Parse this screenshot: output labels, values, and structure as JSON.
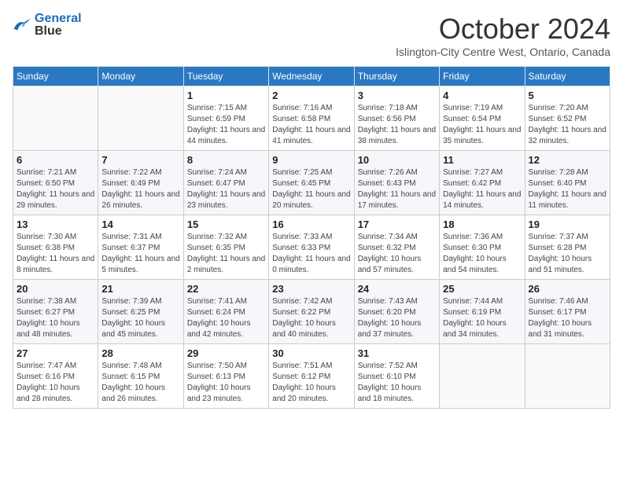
{
  "header": {
    "logo_line1": "General",
    "logo_line2": "Blue",
    "month": "October 2024",
    "location": "Islington-City Centre West, Ontario, Canada"
  },
  "weekdays": [
    "Sunday",
    "Monday",
    "Tuesday",
    "Wednesday",
    "Thursday",
    "Friday",
    "Saturday"
  ],
  "weeks": [
    [
      {
        "day": "",
        "detail": ""
      },
      {
        "day": "",
        "detail": ""
      },
      {
        "day": "1",
        "detail": "Sunrise: 7:15 AM\nSunset: 6:59 PM\nDaylight: 11 hours and 44 minutes."
      },
      {
        "day": "2",
        "detail": "Sunrise: 7:16 AM\nSunset: 6:58 PM\nDaylight: 11 hours and 41 minutes."
      },
      {
        "day": "3",
        "detail": "Sunrise: 7:18 AM\nSunset: 6:56 PM\nDaylight: 11 hours and 38 minutes."
      },
      {
        "day": "4",
        "detail": "Sunrise: 7:19 AM\nSunset: 6:54 PM\nDaylight: 11 hours and 35 minutes."
      },
      {
        "day": "5",
        "detail": "Sunrise: 7:20 AM\nSunset: 6:52 PM\nDaylight: 11 hours and 32 minutes."
      }
    ],
    [
      {
        "day": "6",
        "detail": "Sunrise: 7:21 AM\nSunset: 6:50 PM\nDaylight: 11 hours and 29 minutes."
      },
      {
        "day": "7",
        "detail": "Sunrise: 7:22 AM\nSunset: 6:49 PM\nDaylight: 11 hours and 26 minutes."
      },
      {
        "day": "8",
        "detail": "Sunrise: 7:24 AM\nSunset: 6:47 PM\nDaylight: 11 hours and 23 minutes."
      },
      {
        "day": "9",
        "detail": "Sunrise: 7:25 AM\nSunset: 6:45 PM\nDaylight: 11 hours and 20 minutes."
      },
      {
        "day": "10",
        "detail": "Sunrise: 7:26 AM\nSunset: 6:43 PM\nDaylight: 11 hours and 17 minutes."
      },
      {
        "day": "11",
        "detail": "Sunrise: 7:27 AM\nSunset: 6:42 PM\nDaylight: 11 hours and 14 minutes."
      },
      {
        "day": "12",
        "detail": "Sunrise: 7:28 AM\nSunset: 6:40 PM\nDaylight: 11 hours and 11 minutes."
      }
    ],
    [
      {
        "day": "13",
        "detail": "Sunrise: 7:30 AM\nSunset: 6:38 PM\nDaylight: 11 hours and 8 minutes."
      },
      {
        "day": "14",
        "detail": "Sunrise: 7:31 AM\nSunset: 6:37 PM\nDaylight: 11 hours and 5 minutes."
      },
      {
        "day": "15",
        "detail": "Sunrise: 7:32 AM\nSunset: 6:35 PM\nDaylight: 11 hours and 2 minutes."
      },
      {
        "day": "16",
        "detail": "Sunrise: 7:33 AM\nSunset: 6:33 PM\nDaylight: 11 hours and 0 minutes."
      },
      {
        "day": "17",
        "detail": "Sunrise: 7:34 AM\nSunset: 6:32 PM\nDaylight: 10 hours and 57 minutes."
      },
      {
        "day": "18",
        "detail": "Sunrise: 7:36 AM\nSunset: 6:30 PM\nDaylight: 10 hours and 54 minutes."
      },
      {
        "day": "19",
        "detail": "Sunrise: 7:37 AM\nSunset: 6:28 PM\nDaylight: 10 hours and 51 minutes."
      }
    ],
    [
      {
        "day": "20",
        "detail": "Sunrise: 7:38 AM\nSunset: 6:27 PM\nDaylight: 10 hours and 48 minutes."
      },
      {
        "day": "21",
        "detail": "Sunrise: 7:39 AM\nSunset: 6:25 PM\nDaylight: 10 hours and 45 minutes."
      },
      {
        "day": "22",
        "detail": "Sunrise: 7:41 AM\nSunset: 6:24 PM\nDaylight: 10 hours and 42 minutes."
      },
      {
        "day": "23",
        "detail": "Sunrise: 7:42 AM\nSunset: 6:22 PM\nDaylight: 10 hours and 40 minutes."
      },
      {
        "day": "24",
        "detail": "Sunrise: 7:43 AM\nSunset: 6:20 PM\nDaylight: 10 hours and 37 minutes."
      },
      {
        "day": "25",
        "detail": "Sunrise: 7:44 AM\nSunset: 6:19 PM\nDaylight: 10 hours and 34 minutes."
      },
      {
        "day": "26",
        "detail": "Sunrise: 7:46 AM\nSunset: 6:17 PM\nDaylight: 10 hours and 31 minutes."
      }
    ],
    [
      {
        "day": "27",
        "detail": "Sunrise: 7:47 AM\nSunset: 6:16 PM\nDaylight: 10 hours and 28 minutes."
      },
      {
        "day": "28",
        "detail": "Sunrise: 7:48 AM\nSunset: 6:15 PM\nDaylight: 10 hours and 26 minutes."
      },
      {
        "day": "29",
        "detail": "Sunrise: 7:50 AM\nSunset: 6:13 PM\nDaylight: 10 hours and 23 minutes."
      },
      {
        "day": "30",
        "detail": "Sunrise: 7:51 AM\nSunset: 6:12 PM\nDaylight: 10 hours and 20 minutes."
      },
      {
        "day": "31",
        "detail": "Sunrise: 7:52 AM\nSunset: 6:10 PM\nDaylight: 10 hours and 18 minutes."
      },
      {
        "day": "",
        "detail": ""
      },
      {
        "day": "",
        "detail": ""
      }
    ]
  ]
}
